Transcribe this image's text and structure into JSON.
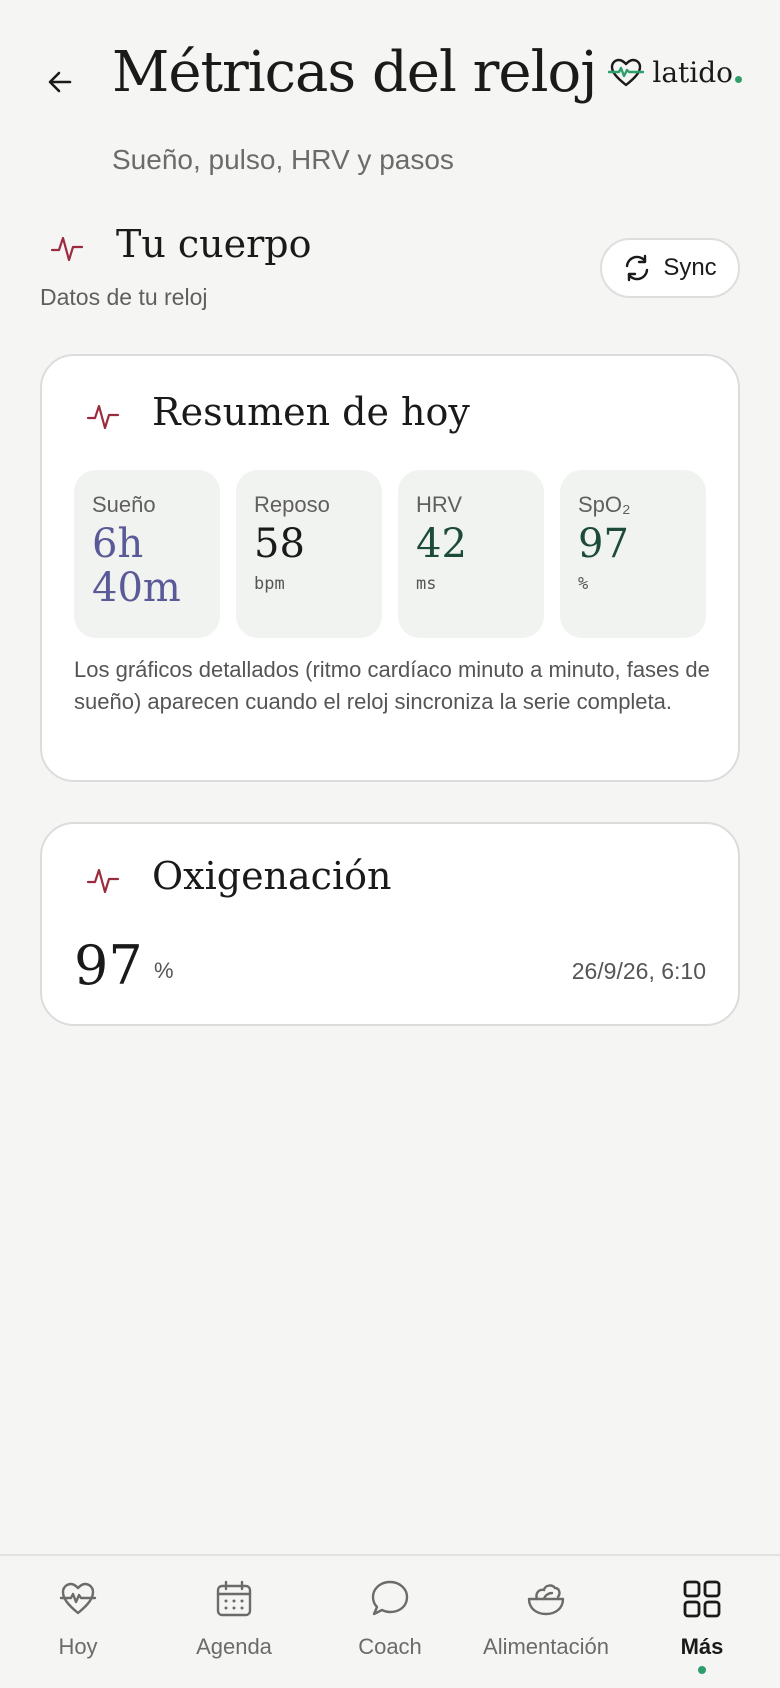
{
  "header": {
    "title": "Métricas del reloj",
    "subtitle": "Sueño, pulso, HRV y pasos",
    "brand": "latido"
  },
  "section": {
    "title": "Tu cuerpo",
    "subtitle": "Datos de tu reloj",
    "sync_label": "Sync"
  },
  "summary": {
    "title": "Resumen de hoy",
    "tiles": [
      {
        "label": "Sueño",
        "value_line1": "6h",
        "value_line2": "40m",
        "unit": ""
      },
      {
        "label": "Reposo",
        "value": "58",
        "unit": "bpm"
      },
      {
        "label": "HRV",
        "value": "42",
        "unit": "ms"
      },
      {
        "label": "SpO₂",
        "value": "97",
        "unit": "%"
      }
    ],
    "note": "Los gráficos detallados (ritmo cardíaco minuto a minuto, fases de sueño) aparecen cuando el reloj sincroniza la serie completa."
  },
  "oxygen": {
    "title": "Oxigenación",
    "value": "97",
    "unit": "%",
    "timestamp": "26/9/26, 6:10"
  },
  "nav": {
    "items": [
      {
        "label": "Hoy",
        "icon": "heart-pulse-icon"
      },
      {
        "label": "Agenda",
        "icon": "calendar-icon"
      },
      {
        "label": "Coach",
        "icon": "chat-bubble-icon"
      },
      {
        "label": "Alimentación",
        "icon": "salad-bowl-icon"
      },
      {
        "label": "Más",
        "icon": "grid-icon"
      }
    ],
    "active_index": 4
  },
  "colors": {
    "accent_green": "#2f9e6b",
    "pulse_red": "#9b2c3f",
    "sleep_purple": "#5a5a99",
    "dark_green": "#1d4b3a"
  }
}
